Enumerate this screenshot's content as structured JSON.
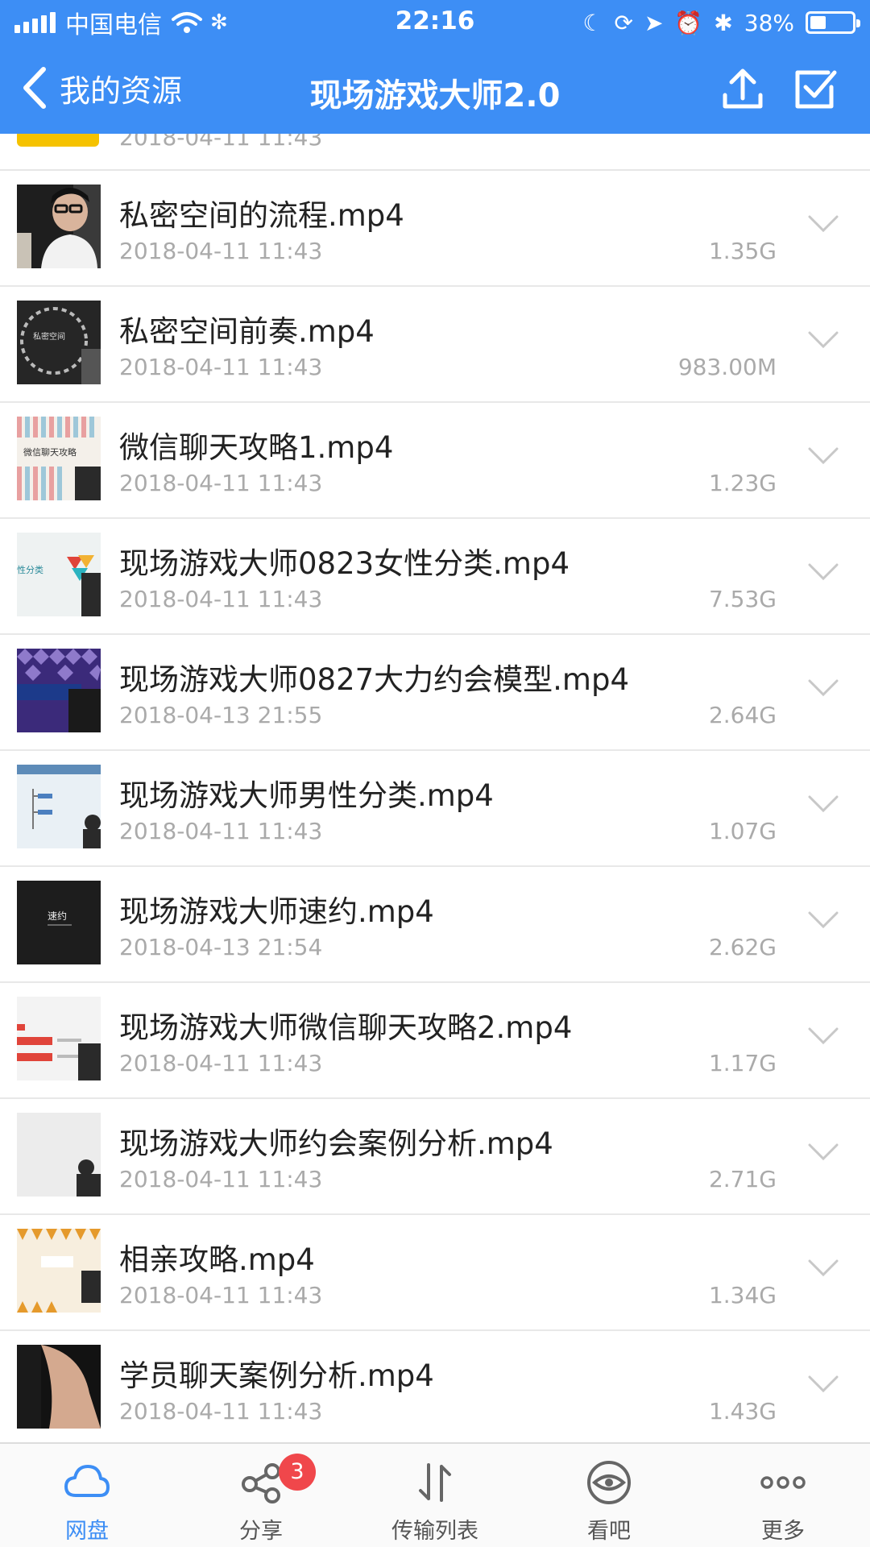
{
  "status_bar": {
    "carrier": "中国电信",
    "time": "22:16",
    "battery": "38%",
    "battery_level": 0.38
  },
  "nav": {
    "back_label": "我的资源",
    "title": "现场游戏大师2.0"
  },
  "partial_row": {
    "date": "2018-04-11 11:43"
  },
  "files": [
    {
      "name": "私密空间的流程.mp4",
      "date": "2018-04-11 11:43",
      "size": "1.35G"
    },
    {
      "name": "私密空间前奏.mp4",
      "date": "2018-04-11 11:43",
      "size": "983.00M"
    },
    {
      "name": "微信聊天攻略1.mp4",
      "date": "2018-04-11 11:43",
      "size": "1.23G"
    },
    {
      "name": "现场游戏大师0823女性分类.mp4",
      "date": "2018-04-11 11:43",
      "size": "7.53G"
    },
    {
      "name": "现场游戏大师0827大力约会模型.mp4",
      "date": "2018-04-13 21:55",
      "size": "2.64G"
    },
    {
      "name": "现场游戏大师男性分类.mp4",
      "date": "2018-04-11 11:43",
      "size": "1.07G"
    },
    {
      "name": "现场游戏大师速约.mp4",
      "date": "2018-04-13 21:54",
      "size": "2.62G"
    },
    {
      "name": "现场游戏大师微信聊天攻略2.mp4",
      "date": "2018-04-11 11:43",
      "size": "1.17G"
    },
    {
      "name": "现场游戏大师约会案例分析.mp4",
      "date": "2018-04-11 11:43",
      "size": "2.71G"
    },
    {
      "name": "相亲攻略.mp4",
      "date": "2018-04-11 11:43",
      "size": "1.34G"
    },
    {
      "name": "学员聊天案例分析.mp4",
      "date": "2018-04-11 11:43",
      "size": "1.43G"
    }
  ],
  "thumbnail_text": {
    "t1": "私密空间",
    "t2": "微信聊天攻略",
    "t3": "性分类",
    "t6": "速约"
  },
  "tabs": [
    {
      "label": "网盘",
      "active": true
    },
    {
      "label": "分享",
      "badge": "3"
    },
    {
      "label": "传输列表"
    },
    {
      "label": "看吧"
    },
    {
      "label": "更多"
    }
  ],
  "colors": {
    "accent": "#3d8ef5",
    "badge": "#f0474b",
    "meta_text": "#aaaaaa"
  }
}
